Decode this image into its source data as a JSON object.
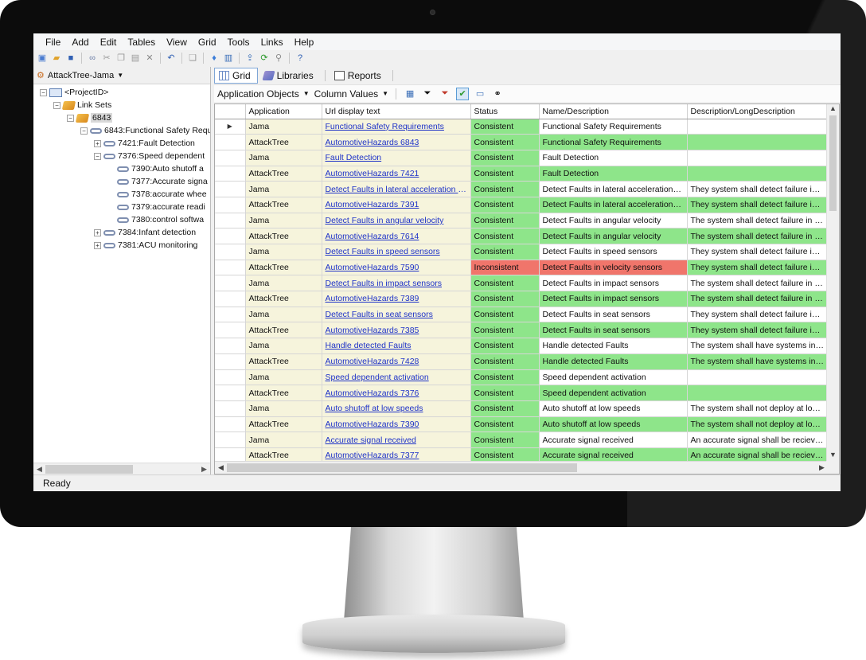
{
  "menu": [
    "File",
    "Add",
    "Edit",
    "Tables",
    "View",
    "Grid",
    "Tools",
    "Links",
    "Help"
  ],
  "left": {
    "project_selector": "AttackTree-Jama",
    "tree": [
      {
        "label": "<ProjectID>",
        "icon": "root-icon",
        "expander": "−"
      },
      {
        "label": "Link Sets",
        "icon": "folder-icon",
        "expander": "−"
      },
      {
        "label": "6843",
        "icon": "folder-icon",
        "expander": "−",
        "selected": true
      },
      {
        "label": "6843:Functional Safety Requ",
        "icon": "link-icon",
        "expander": "−"
      },
      {
        "label": "7421:Fault Detection",
        "icon": "link-icon",
        "expander": "+"
      },
      {
        "label": "7376:Speed dependent",
        "icon": "link-icon",
        "expander": "−"
      },
      {
        "label": "7390:Auto shutoff a",
        "icon": "link-icon",
        "expander": ""
      },
      {
        "label": "7377:Accurate signa",
        "icon": "link-icon",
        "expander": ""
      },
      {
        "label": "7378:accurate whee",
        "icon": "link-icon",
        "expander": ""
      },
      {
        "label": "7379:accurate readi",
        "icon": "link-icon",
        "expander": ""
      },
      {
        "label": "7380:control softwa",
        "icon": "link-icon",
        "expander": ""
      },
      {
        "label": "7384:Infant detection",
        "icon": "link-icon",
        "expander": "+"
      },
      {
        "label": "7381:ACU monitoring",
        "icon": "link-icon",
        "expander": "+"
      }
    ]
  },
  "tabs": {
    "grid": "Grid",
    "libraries": "Libraries",
    "reports": "Reports"
  },
  "subbar": {
    "application_objects": "Application Objects",
    "column_values": "Column Values"
  },
  "grid": {
    "columns": [
      "Application",
      "Url display text",
      "Status",
      "Name/Description",
      "Description/LongDescription"
    ],
    "rows": [
      {
        "app": "Jama",
        "url": "Functional Safety Requirements",
        "status": "Consistent",
        "name": "Functional Safety Requirements",
        "desc": ""
      },
      {
        "app": "AttackTree",
        "url": "AutomotiveHazards 6843",
        "status": "Consistent",
        "name": "Functional Safety Requirements",
        "desc": ""
      },
      {
        "app": "Jama",
        "url": "Fault Detection",
        "status": "Consistent",
        "name": "Fault Detection",
        "desc": ""
      },
      {
        "app": "AttackTree",
        "url": "AutomotiveHazards 7421",
        "status": "Consistent",
        "name": "Fault Detection",
        "desc": ""
      },
      {
        "app": "Jama",
        "url": "Detect Faults in lateral acceleration s...",
        "status": "Consistent",
        "name": "Detect Faults in lateral acceleration se...",
        "desc": "They system shall detect failure in later"
      },
      {
        "app": "AttackTree",
        "url": "AutomotiveHazards 7391",
        "status": "Consistent",
        "name": "Detect Faults in lateral acceleration se...",
        "desc": "They system shall detect failure in later"
      },
      {
        "app": "Jama",
        "url": "Detect Faults in angular velocity",
        "status": "Consistent",
        "name": "Detect Faults in angular velocity",
        "desc": "The system shall detect failure in angul"
      },
      {
        "app": "AttackTree",
        "url": "AutomotiveHazards 7614",
        "status": "Consistent",
        "name": "Detect Faults in angular velocity",
        "desc": "The system shall detect failure in angul"
      },
      {
        "app": "Jama",
        "url": "Detect Faults in speed sensors",
        "status": "Consistent",
        "name": "Detect Faults in speed sensors",
        "desc": "They system shall detect failure in spee"
      },
      {
        "app": "AttackTree",
        "url": "AutomotiveHazards 7590",
        "status": "Inconsistent",
        "name": "Detect Faults in velocity sensors",
        "desc": "They system shall detect failure in spee"
      },
      {
        "app": "Jama",
        "url": "Detect Faults in impact sensors",
        "status": "Consistent",
        "name": "Detect Faults in impact sensors",
        "desc": "The system shall detect failure in impac"
      },
      {
        "app": "AttackTree",
        "url": "AutomotiveHazards 7389",
        "status": "Consistent",
        "name": "Detect Faults in impact sensors",
        "desc": "The system shall detect failure in impac"
      },
      {
        "app": "Jama",
        "url": "Detect Faults in seat sensors",
        "status": "Consistent",
        "name": "Detect Faults in seat sensors",
        "desc": "They system shall detect failure in seat"
      },
      {
        "app": "AttackTree",
        "url": "AutomotiveHazards 7385",
        "status": "Consistent",
        "name": "Detect Faults in seat sensors",
        "desc": "They system shall detect failure in seat"
      },
      {
        "app": "Jama",
        "url": "Handle detected Faults",
        "status": "Consistent",
        "name": "Handle detected Faults",
        "desc": "The system shall have systems in place"
      },
      {
        "app": "AttackTree",
        "url": "AutomotiveHazards 7428",
        "status": "Consistent",
        "name": "Handle detected Faults",
        "desc": "The system shall have systems in place"
      },
      {
        "app": "Jama",
        "url": "Speed dependent activation",
        "status": "Consistent",
        "name": "Speed dependent activation",
        "desc": ""
      },
      {
        "app": "AttackTree",
        "url": "AutomotiveHazards 7376",
        "status": "Consistent",
        "name": "Speed dependent activation",
        "desc": ""
      },
      {
        "app": "Jama",
        "url": "Auto shutoff at low speeds",
        "status": "Consistent",
        "name": "Auto shutoff at low speeds",
        "desc": "The system shall not deploy at low spe"
      },
      {
        "app": "AttackTree",
        "url": "AutomotiveHazards 7390",
        "status": "Consistent",
        "name": "Auto shutoff at low speeds",
        "desc": "The system shall not deploy at low spe"
      },
      {
        "app": "Jama",
        "url": "Accurate signal received",
        "status": "Consistent",
        "name": "Accurate signal received",
        "desc": "An accurate  signal shall be recieved"
      },
      {
        "app": "AttackTree",
        "url": "AutomotiveHazards 7377",
        "status": "Consistent",
        "name": "Accurate signal received",
        "desc": "An accurate  signal shall be recieved"
      }
    ]
  },
  "status_bar": "Ready",
  "colors": {
    "consistent": "#8ee58a",
    "inconsistent": "#f0756b",
    "link": "#1e32c8"
  }
}
